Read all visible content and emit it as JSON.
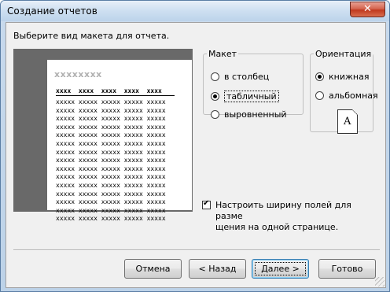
{
  "window": {
    "title": "Создание отчетов",
    "close_glyph": "✕"
  },
  "prompt": "Выберите вид макета для отчета.",
  "preview": {
    "title_placeholder": "xxxxxxxx",
    "header_row": "xxxx  xxxx  xxxx  xxxx  xxxx",
    "data_row": "xxxxx xxxxx xxxxx xxxxx xxxxx",
    "row_count": 15
  },
  "layout_group": {
    "legend": "Макет",
    "options": [
      {
        "label": "в столбец",
        "selected": false
      },
      {
        "label": "табличный",
        "selected": true
      },
      {
        "label": "выровненный",
        "selected": false
      }
    ]
  },
  "orientation_group": {
    "legend": "Ориентация",
    "options": [
      {
        "label": "книжная",
        "selected": true
      },
      {
        "label": "альбомная",
        "selected": false
      }
    ],
    "icon_letter": "A"
  },
  "fit_checkbox": {
    "checked": true,
    "label_line1": "Настроить ширину полей для разме",
    "label_line2": "щения на одной странице."
  },
  "buttons": {
    "cancel": "Отмена",
    "back": "< Назад",
    "next": "Далее >",
    "finish": "Готово"
  }
}
